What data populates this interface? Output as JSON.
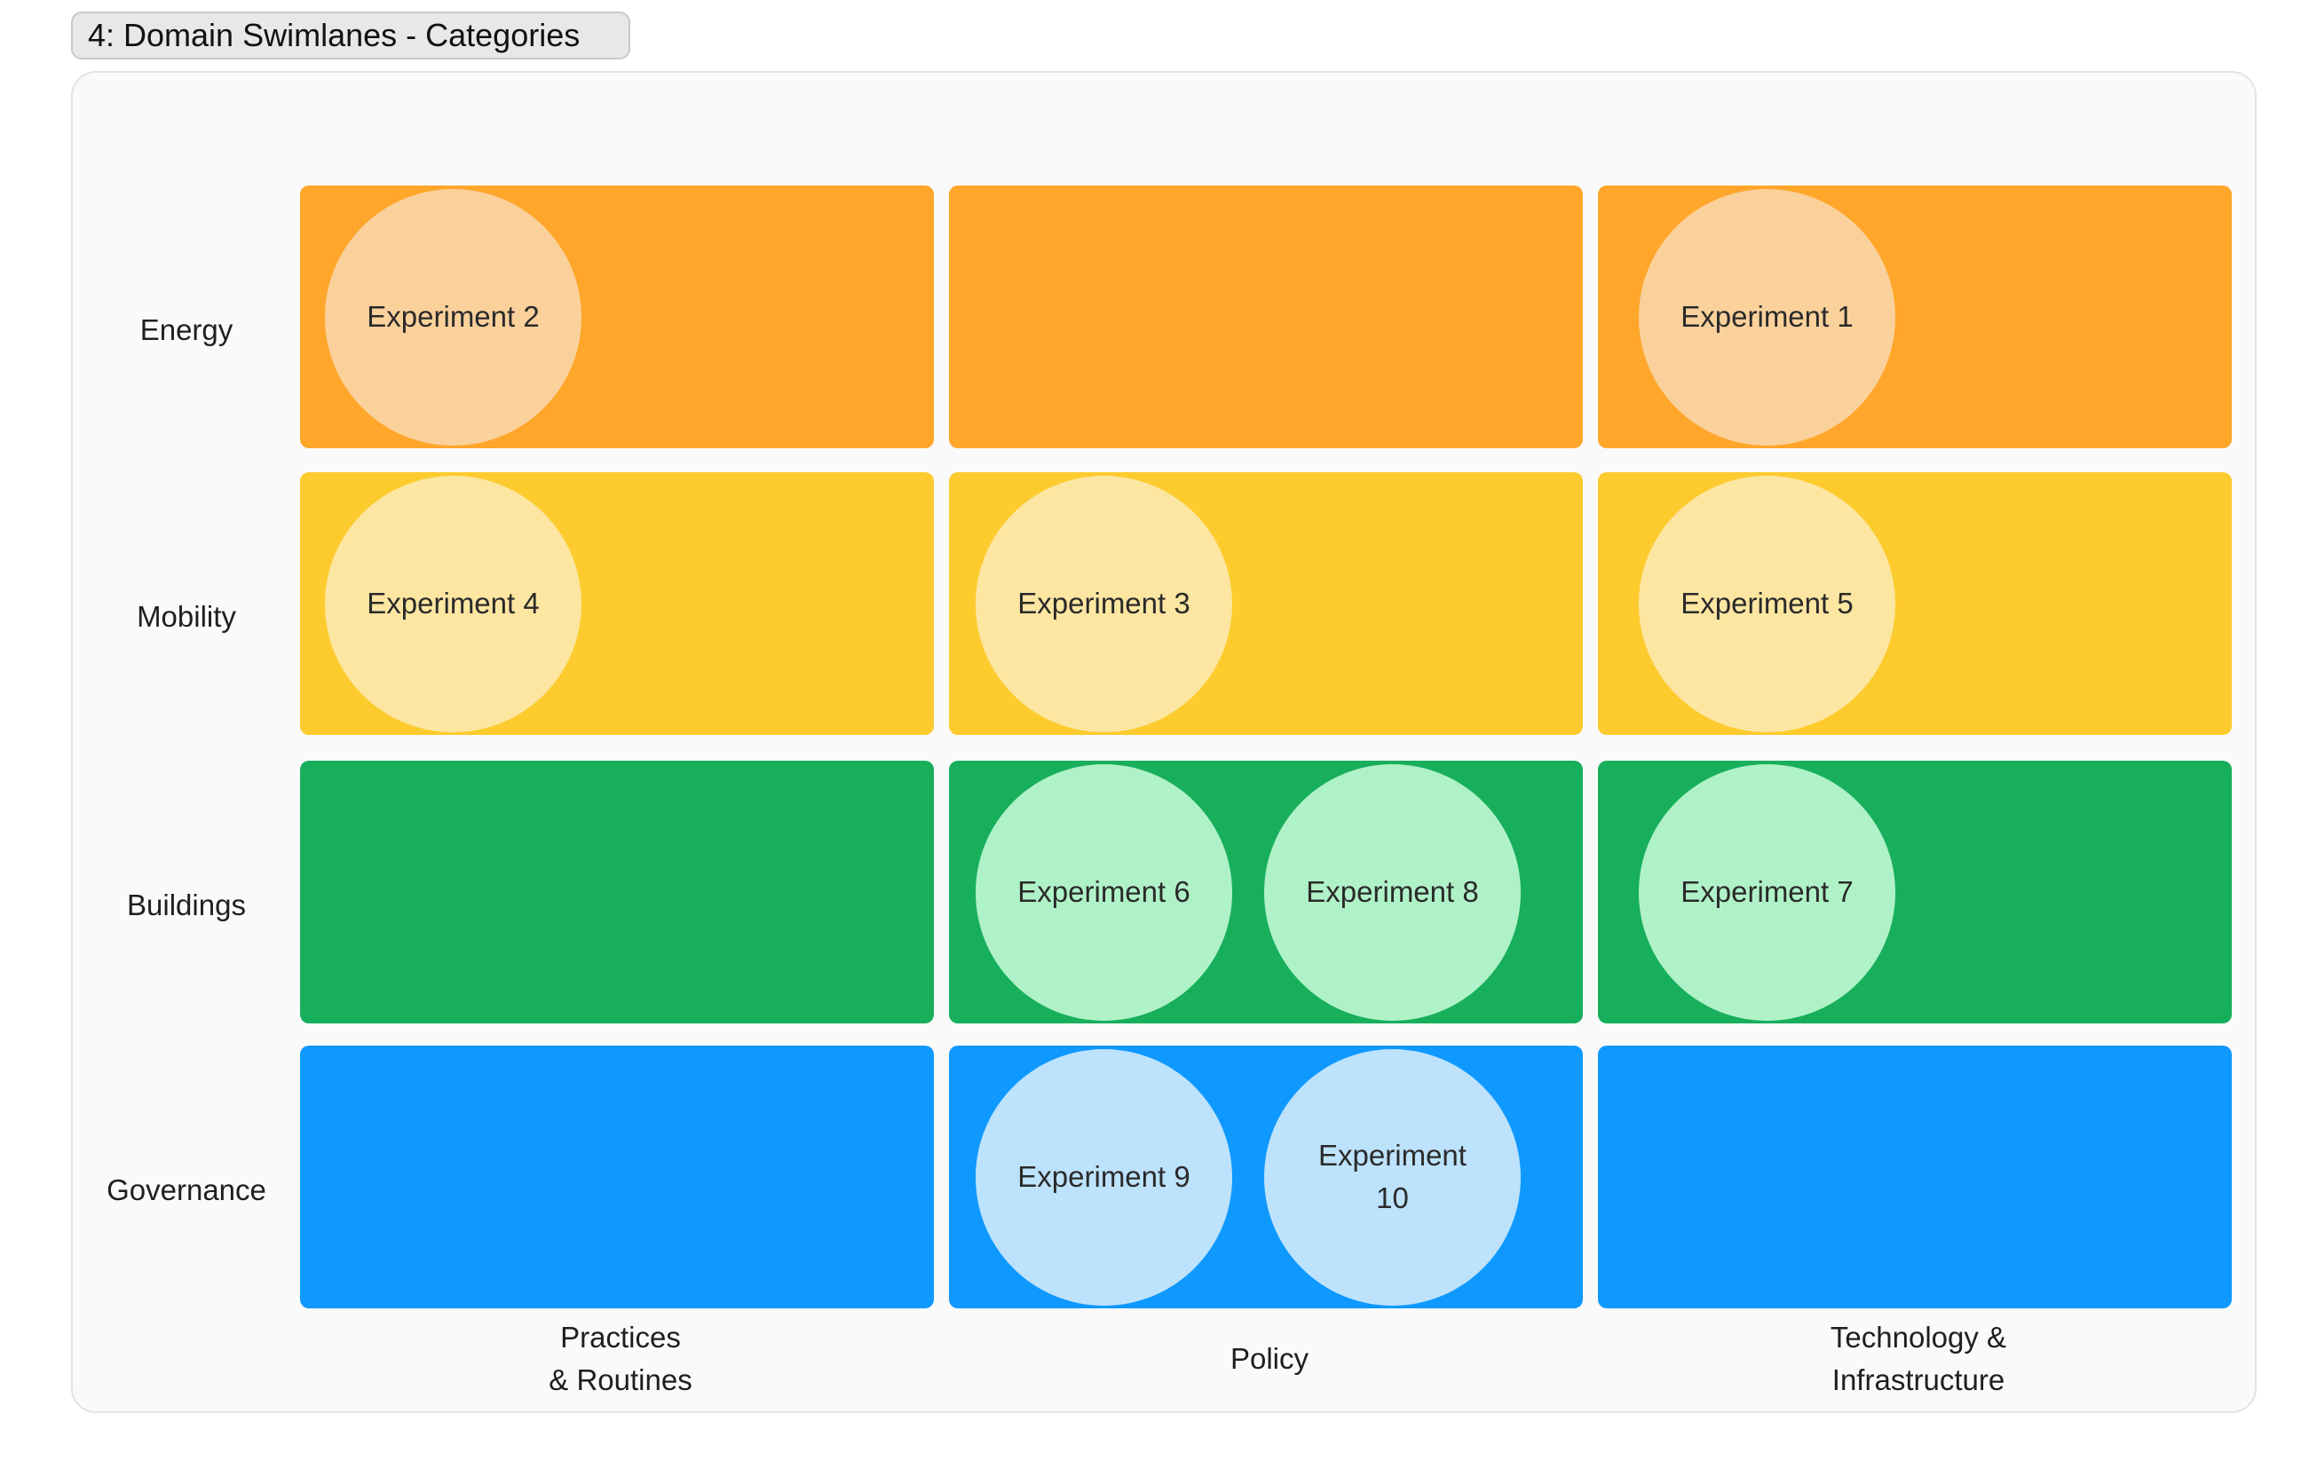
{
  "title": "4: Domain Swimlanes - Categories",
  "rows": [
    {
      "label": "Energy",
      "color": "#FFA62B",
      "bubble_color": "#FBD19B"
    },
    {
      "label": "Mobility",
      "color": "#FDCB2E",
      "bubble_color": "#FDE6A1"
    },
    {
      "label": "Buildings",
      "color": "#18AF5C",
      "bubble_color": "#B0F2C8"
    },
    {
      "label": "Governance",
      "color": "#0F99FF",
      "bubble_color": "#BDE2FC"
    }
  ],
  "columns": [
    {
      "label": "Practices\n& Routines"
    },
    {
      "label": "Policy"
    },
    {
      "label": "Technology &\nInfrastructure"
    }
  ],
  "experiments": [
    {
      "label": "Experiment 2",
      "row": 0,
      "col": 0,
      "slot": 0
    },
    {
      "label": "Experiment 1",
      "row": 0,
      "col": 2,
      "slot": 0
    },
    {
      "label": "Experiment 4",
      "row": 1,
      "col": 0,
      "slot": 0
    },
    {
      "label": "Experiment 3",
      "row": 1,
      "col": 1,
      "slot": 0
    },
    {
      "label": "Experiment 5",
      "row": 1,
      "col": 2,
      "slot": 0
    },
    {
      "label": "Experiment 6",
      "row": 2,
      "col": 1,
      "slot": 0
    },
    {
      "label": "Experiment 8",
      "row": 2,
      "col": 1,
      "slot": 1
    },
    {
      "label": "Experiment 7",
      "row": 2,
      "col": 2,
      "slot": 0
    },
    {
      "label": "Experiment 9",
      "row": 3,
      "col": 1,
      "slot": 0
    },
    {
      "label": "Experiment 10",
      "row": 3,
      "col": 1,
      "slot": 1
    }
  ]
}
